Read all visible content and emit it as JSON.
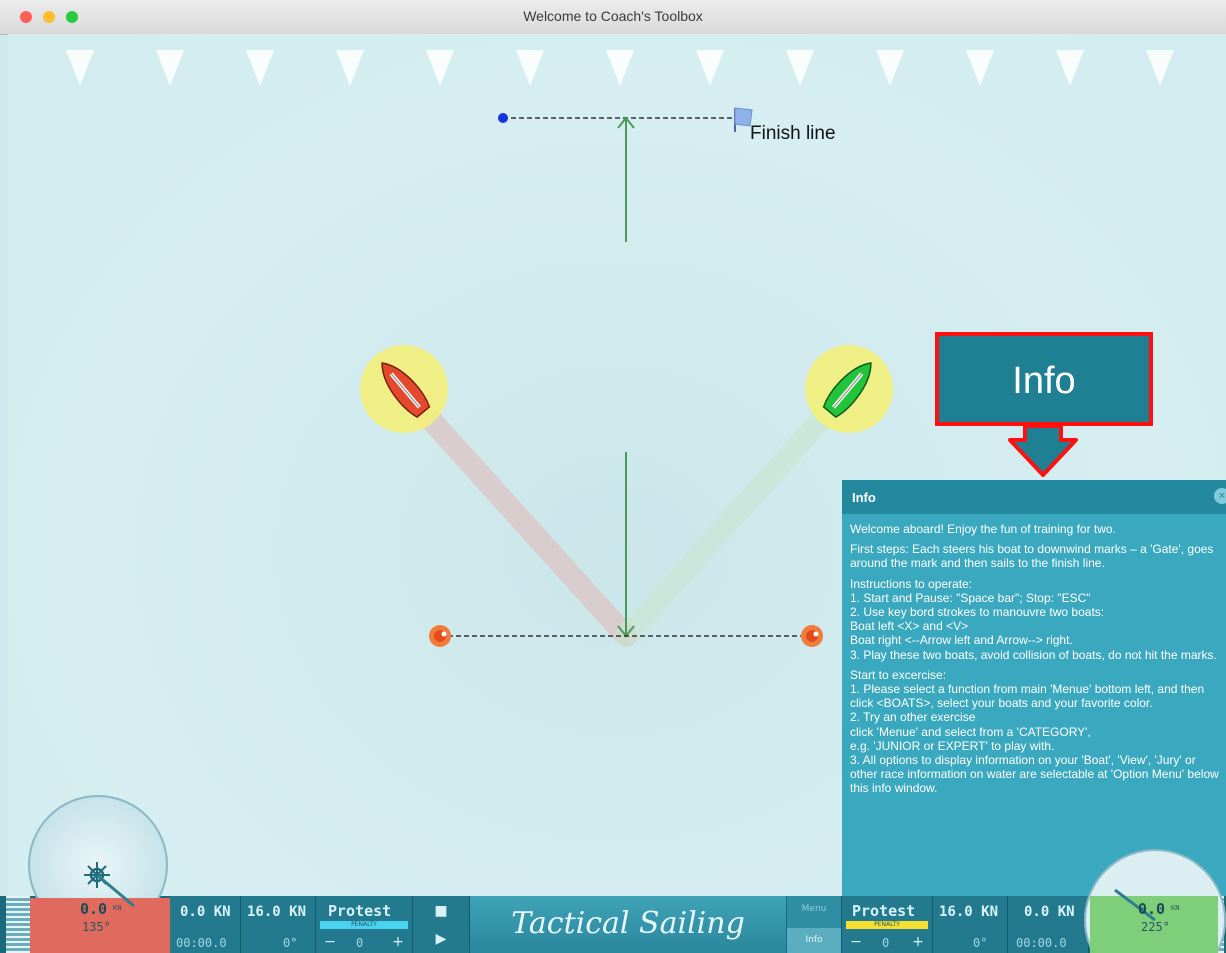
{
  "window": {
    "title": "Welcome to Coach's Toolbox"
  },
  "course": {
    "finish_label": "Finish line"
  },
  "callout": {
    "label": "Info"
  },
  "info_panel": {
    "title": "Info",
    "close": "×",
    "paragraphs": [
      "Welcome aboard! Enjoy the fun of training for two.",
      "First steps: Each steers his boat to downwind marks – a 'Gate', goes around the mark and then sails to the finish line.",
      "Instructions to operate:\n1. Start and Pause: \"Space bar\"; Stop: \"ESC\"\n2. Use key bord strokes to manouvre two boats:\nBoat left <X> and <V>\nBoat right <--Arrow left and Arrow--> right.\n3. Play these two boats, avoid collision of boats, do not hit the marks.",
      "Start to excercise:\n1. Please select a function from main 'Menue' bottom left, and then click <BOATS>, select your boats and your favorite color.\n2. Try an other exercise\nclick 'Menue' and select from a 'CATEGORY',\ne.g. 'JUNIOR or EXPERT' to play with.\n3. All options to display information on your 'Boat', 'View', 'Jury' or other race information on water are selectable at 'Option Menu' below this info window."
    ]
  },
  "hud_left": {
    "speed": "0.0",
    "speed_unit": "KN",
    "heading": "135°",
    "boat_speed": "0.0 KN",
    "wind_speed": "16.0 KN",
    "protest": "Protest",
    "penalty": "PENALTY",
    "timer": "00:00.0",
    "angle": "0°",
    "counter": "0",
    "minus": "−",
    "plus": "+"
  },
  "hud_right": {
    "speed": "0.0",
    "speed_unit": "KN",
    "heading": "225°",
    "boat_speed": "0.0 KN",
    "wind_speed": "16.0 KN",
    "protest": "Protest",
    "penalty": "PENALTY",
    "timer": "00:00.0",
    "angle": "0°",
    "counter": "0",
    "minus": "−",
    "plus": "+"
  },
  "controls": {
    "stop": "■",
    "play": "▶",
    "menu": "Menu",
    "info": "Info"
  },
  "brand": {
    "label": "Tactical Sailing"
  },
  "colors": {
    "boat_left": "#e5492b",
    "boat_right": "#22c43a",
    "boat_halo": "#f3f07a",
    "panel": "#3aa8be",
    "callout_border": "#ff1010"
  },
  "icons": {
    "sun": "sun-icon",
    "flag": "flag-icon"
  }
}
